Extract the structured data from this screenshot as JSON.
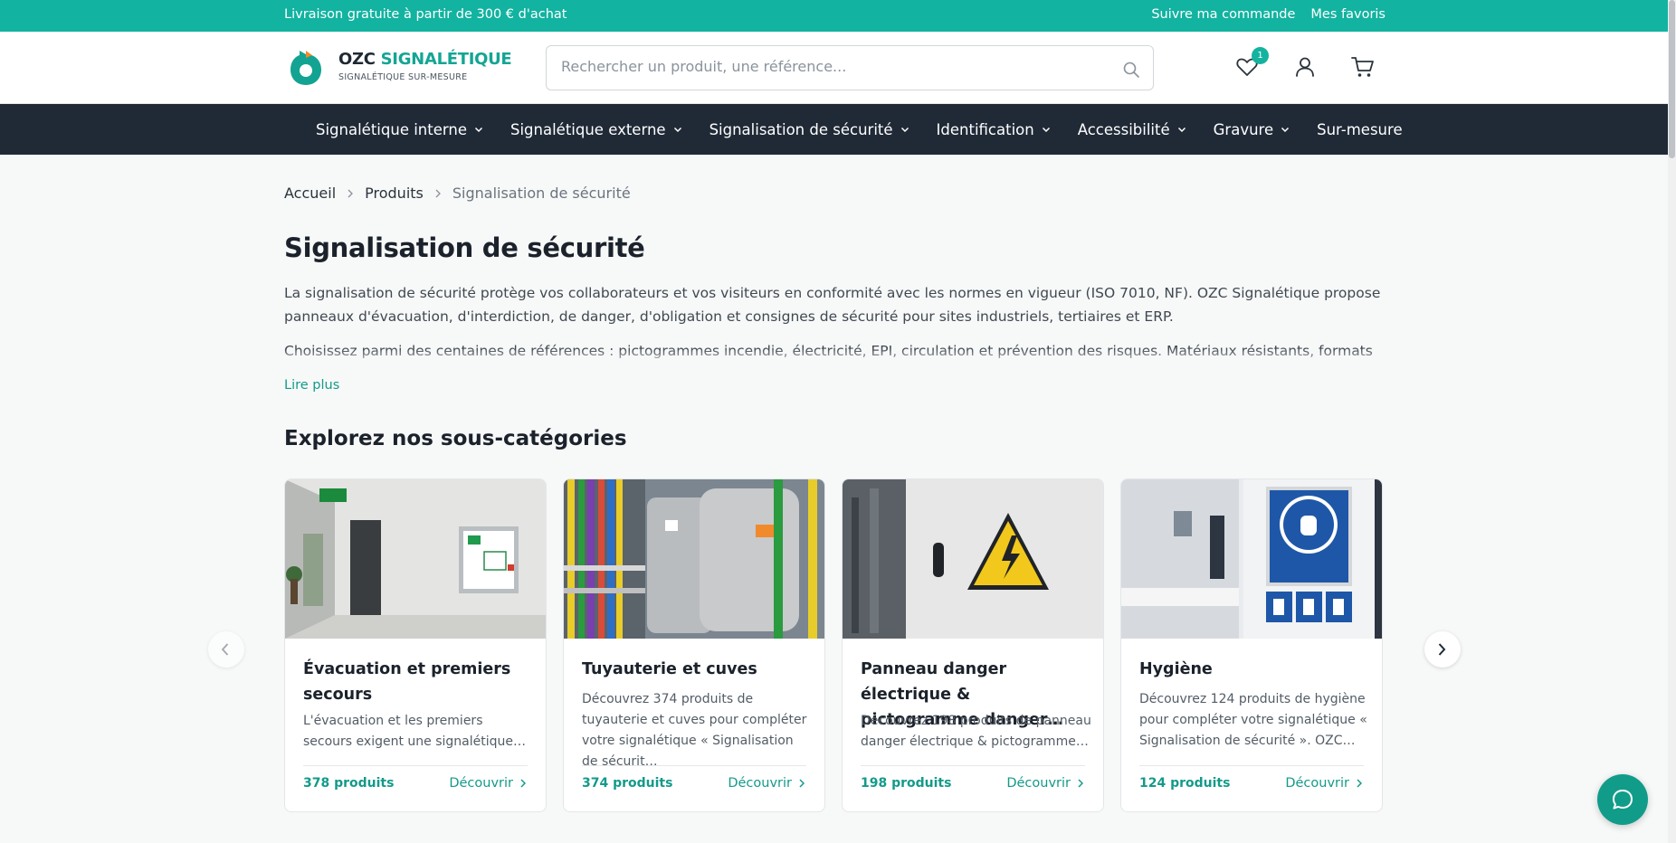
{
  "topbar": {
    "promo": "Livraison gratuite à partir de 300 € d'achat",
    "links": [
      "Suivre ma commande",
      "Mes favoris"
    ]
  },
  "header": {
    "brand_part1": "OZC ",
    "brand_part2": "SIGNALÉTIQUE",
    "brand_tagline": "SIGNALÉTIQUE SUR-MESURE",
    "search_placeholder": "Rechercher un produit, une référence...",
    "favorites_count": "1",
    "icons": [
      "heart-icon",
      "user-icon",
      "cart-icon"
    ]
  },
  "nav": {
    "items": [
      {
        "label": "Signalétique interne",
        "dropdown": true
      },
      {
        "label": "Signalétique externe",
        "dropdown": true
      },
      {
        "label": "Signalisation de sécurité",
        "dropdown": true
      },
      {
        "label": "Identification",
        "dropdown": true
      },
      {
        "label": "Accessibilité",
        "dropdown": true
      },
      {
        "label": "Gravure",
        "dropdown": true
      },
      {
        "label": "Sur-mesure",
        "dropdown": false
      }
    ]
  },
  "breadcrumb": {
    "items": [
      "Accueil",
      "Produits"
    ],
    "current": "Signalisation de sécurité"
  },
  "page": {
    "title": "Signalisation de sécurité",
    "description": [
      "La signalisation de sécurité protège vos collaborateurs et vos visiteurs en conformité avec les normes en vigueur (ISO 7010, NF). OZC Signalétique propose panneaux d'évacuation, d'interdiction, de danger, d'obligation et consignes de sécurité pour sites industriels, tertiaires et ERP.",
      "Choisissez parmi des centaines de références : pictogrammes incendie, électricité, EPI, circulation et prévention des risques. Matériaux résistants, formats variés, fixation"
    ],
    "read_more": "Lire plus",
    "subcategories_title": "Explorez nos sous-catégories"
  },
  "cards": [
    {
      "title": "Évacuation et premiers secours",
      "text": "L'évacuation et les premiers secours exigent une signalétique…",
      "count": "378 produits",
      "cta": "Découvrir"
    },
    {
      "title": "Tuyauterie et cuves",
      "text": "Découvrez 374 produits de tuyauterie et cuves pour compléter votre signalétique « Signalisation de sécurit…",
      "count": "374 produits",
      "cta": "Découvrir"
    },
    {
      "title": "Panneau danger électrique & pictogramme danger…",
      "text": "Découvrez 198 produits de panneau danger électrique & pictogramme…",
      "count": "198 produits",
      "cta": "Découvrir"
    },
    {
      "title": "Hygiène",
      "text": "Découvrez 124 produits de hygiène pour compléter votre signalétique « Signalisation de sécurité ». OZC…",
      "count": "124 produits",
      "cta": "Découvrir"
    }
  ],
  "colors": {
    "brand": "#12b3a0",
    "nav_bg": "#202a37",
    "link": "#139a8a"
  }
}
